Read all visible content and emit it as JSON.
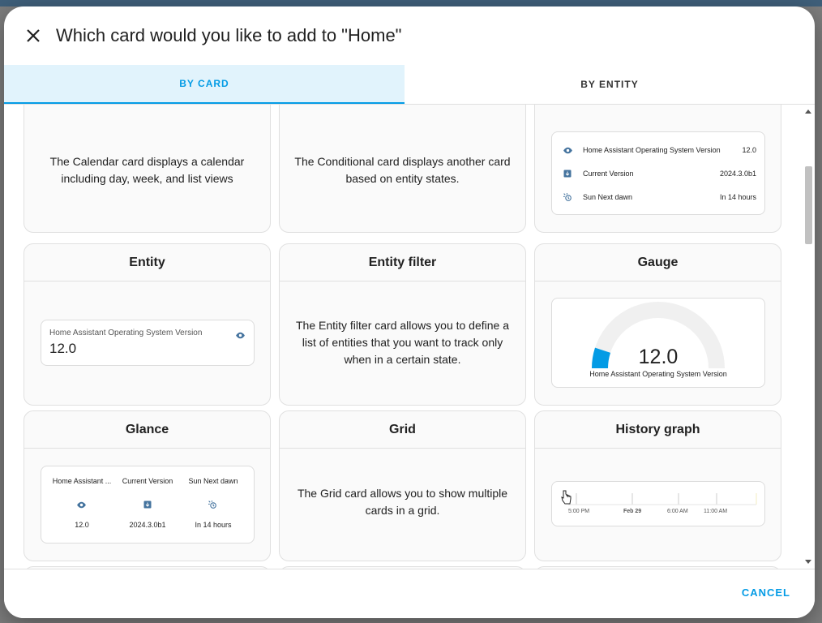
{
  "dialog": {
    "title": "Which card would you like to add to \"Home\"",
    "tabs": [
      {
        "label": "BY CARD",
        "active": true
      },
      {
        "label": "BY ENTITY",
        "active": false
      }
    ],
    "cancel_label": "CANCEL"
  },
  "cards": {
    "calendar": {
      "description": "The Calendar card displays a calendar including day, week, and list views"
    },
    "conditional": {
      "description": "The Conditional card displays another card based on entity states."
    },
    "entities": {
      "rows": [
        {
          "icon": "eye-icon",
          "name": "Home Assistant Operating System Version",
          "value": "12.0"
        },
        {
          "icon": "package-icon",
          "name": "Current Version",
          "value": "2024.3.0b1"
        },
        {
          "icon": "sun-clock-icon",
          "name": "Sun Next dawn",
          "value": "In 14 hours"
        }
      ]
    },
    "entity": {
      "title": "Entity",
      "preview_name": "Home Assistant Operating System Version",
      "preview_value": "12.0",
      "icon": "eye-icon"
    },
    "entity_filter": {
      "title": "Entity filter",
      "description": "The Entity filter card allows you to define a list of entities that you want to track only when in a certain state."
    },
    "gauge": {
      "title": "Gauge",
      "value": "12.0",
      "name": "Home Assistant Operating System Version",
      "fill_fraction": 0.1,
      "colors": {
        "fill": "#039be5",
        "track": "#f0f0f0"
      }
    },
    "glance": {
      "title": "Glance",
      "columns": [
        {
          "name": "Home Assistant ...",
          "icon": "eye-icon",
          "value": "12.0"
        },
        {
          "name": "Current Version",
          "icon": "package-icon",
          "value": "2024.3.0b1"
        },
        {
          "name": "Sun Next dawn",
          "icon": "sun-clock-icon",
          "value": "In 14 hours"
        }
      ]
    },
    "grid": {
      "title": "Grid",
      "description": "The Grid card allows you to show multiple cards in a grid."
    },
    "history_graph": {
      "title": "History graph",
      "ticks": [
        "5:00 PM",
        "Feb 29",
        "6:00 AM",
        "11:00 AM"
      ]
    }
  },
  "colors": {
    "accent": "#039be5",
    "tab_active_bg": "#e1f3fc",
    "icon": "#44739e"
  }
}
